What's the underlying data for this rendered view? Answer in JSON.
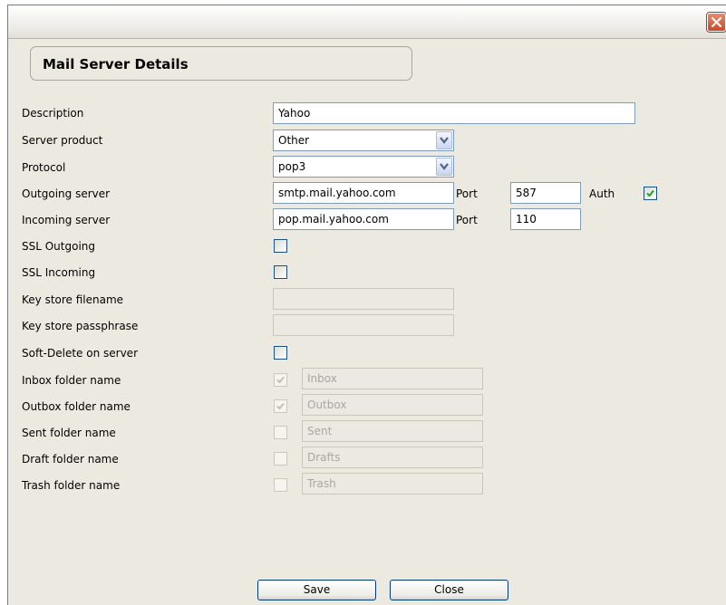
{
  "window": {
    "close_icon": "close-icon"
  },
  "panel": {
    "title": "Mail Server Details"
  },
  "form": {
    "description": {
      "label": "Description",
      "value": "Yahoo"
    },
    "server_product": {
      "label": "Server product",
      "value": "Other"
    },
    "protocol": {
      "label": "Protocol",
      "value": "pop3"
    },
    "outgoing_server": {
      "label": "Outgoing server",
      "value": "smtp.mail.yahoo.com",
      "port_label": "Port",
      "port": "587",
      "auth_label": "Auth",
      "auth_checked": true
    },
    "incoming_server": {
      "label": "Incoming server",
      "value": "pop.mail.yahoo.com",
      "port_label": "Port",
      "port": "110"
    },
    "ssl_outgoing": {
      "label": "SSL Outgoing",
      "checked": false
    },
    "ssl_incoming": {
      "label": "SSL Incoming",
      "checked": false
    },
    "key_store_filename": {
      "label": "Key store filename",
      "value": ""
    },
    "key_store_passphrase": {
      "label": "Key store passphrase",
      "value": ""
    },
    "soft_delete": {
      "label": "Soft-Delete on server",
      "checked": false
    },
    "inbox": {
      "label": "Inbox folder name",
      "value": "Inbox",
      "checked": true
    },
    "outbox": {
      "label": "Outbox folder name",
      "value": "Outbox",
      "checked": true
    },
    "sent": {
      "label": "Sent folder name",
      "value": "Sent",
      "checked": false
    },
    "draft": {
      "label": "Draft folder name",
      "value": "Drafts",
      "checked": false
    },
    "trash": {
      "label": "Trash folder name",
      "value": "Trash",
      "checked": false
    }
  },
  "buttons": {
    "save": "Save",
    "close": "Close"
  },
  "colors": {
    "accent_check": "#21a121",
    "field_border": "#7f9db9",
    "window_bg": "#eceae0"
  }
}
